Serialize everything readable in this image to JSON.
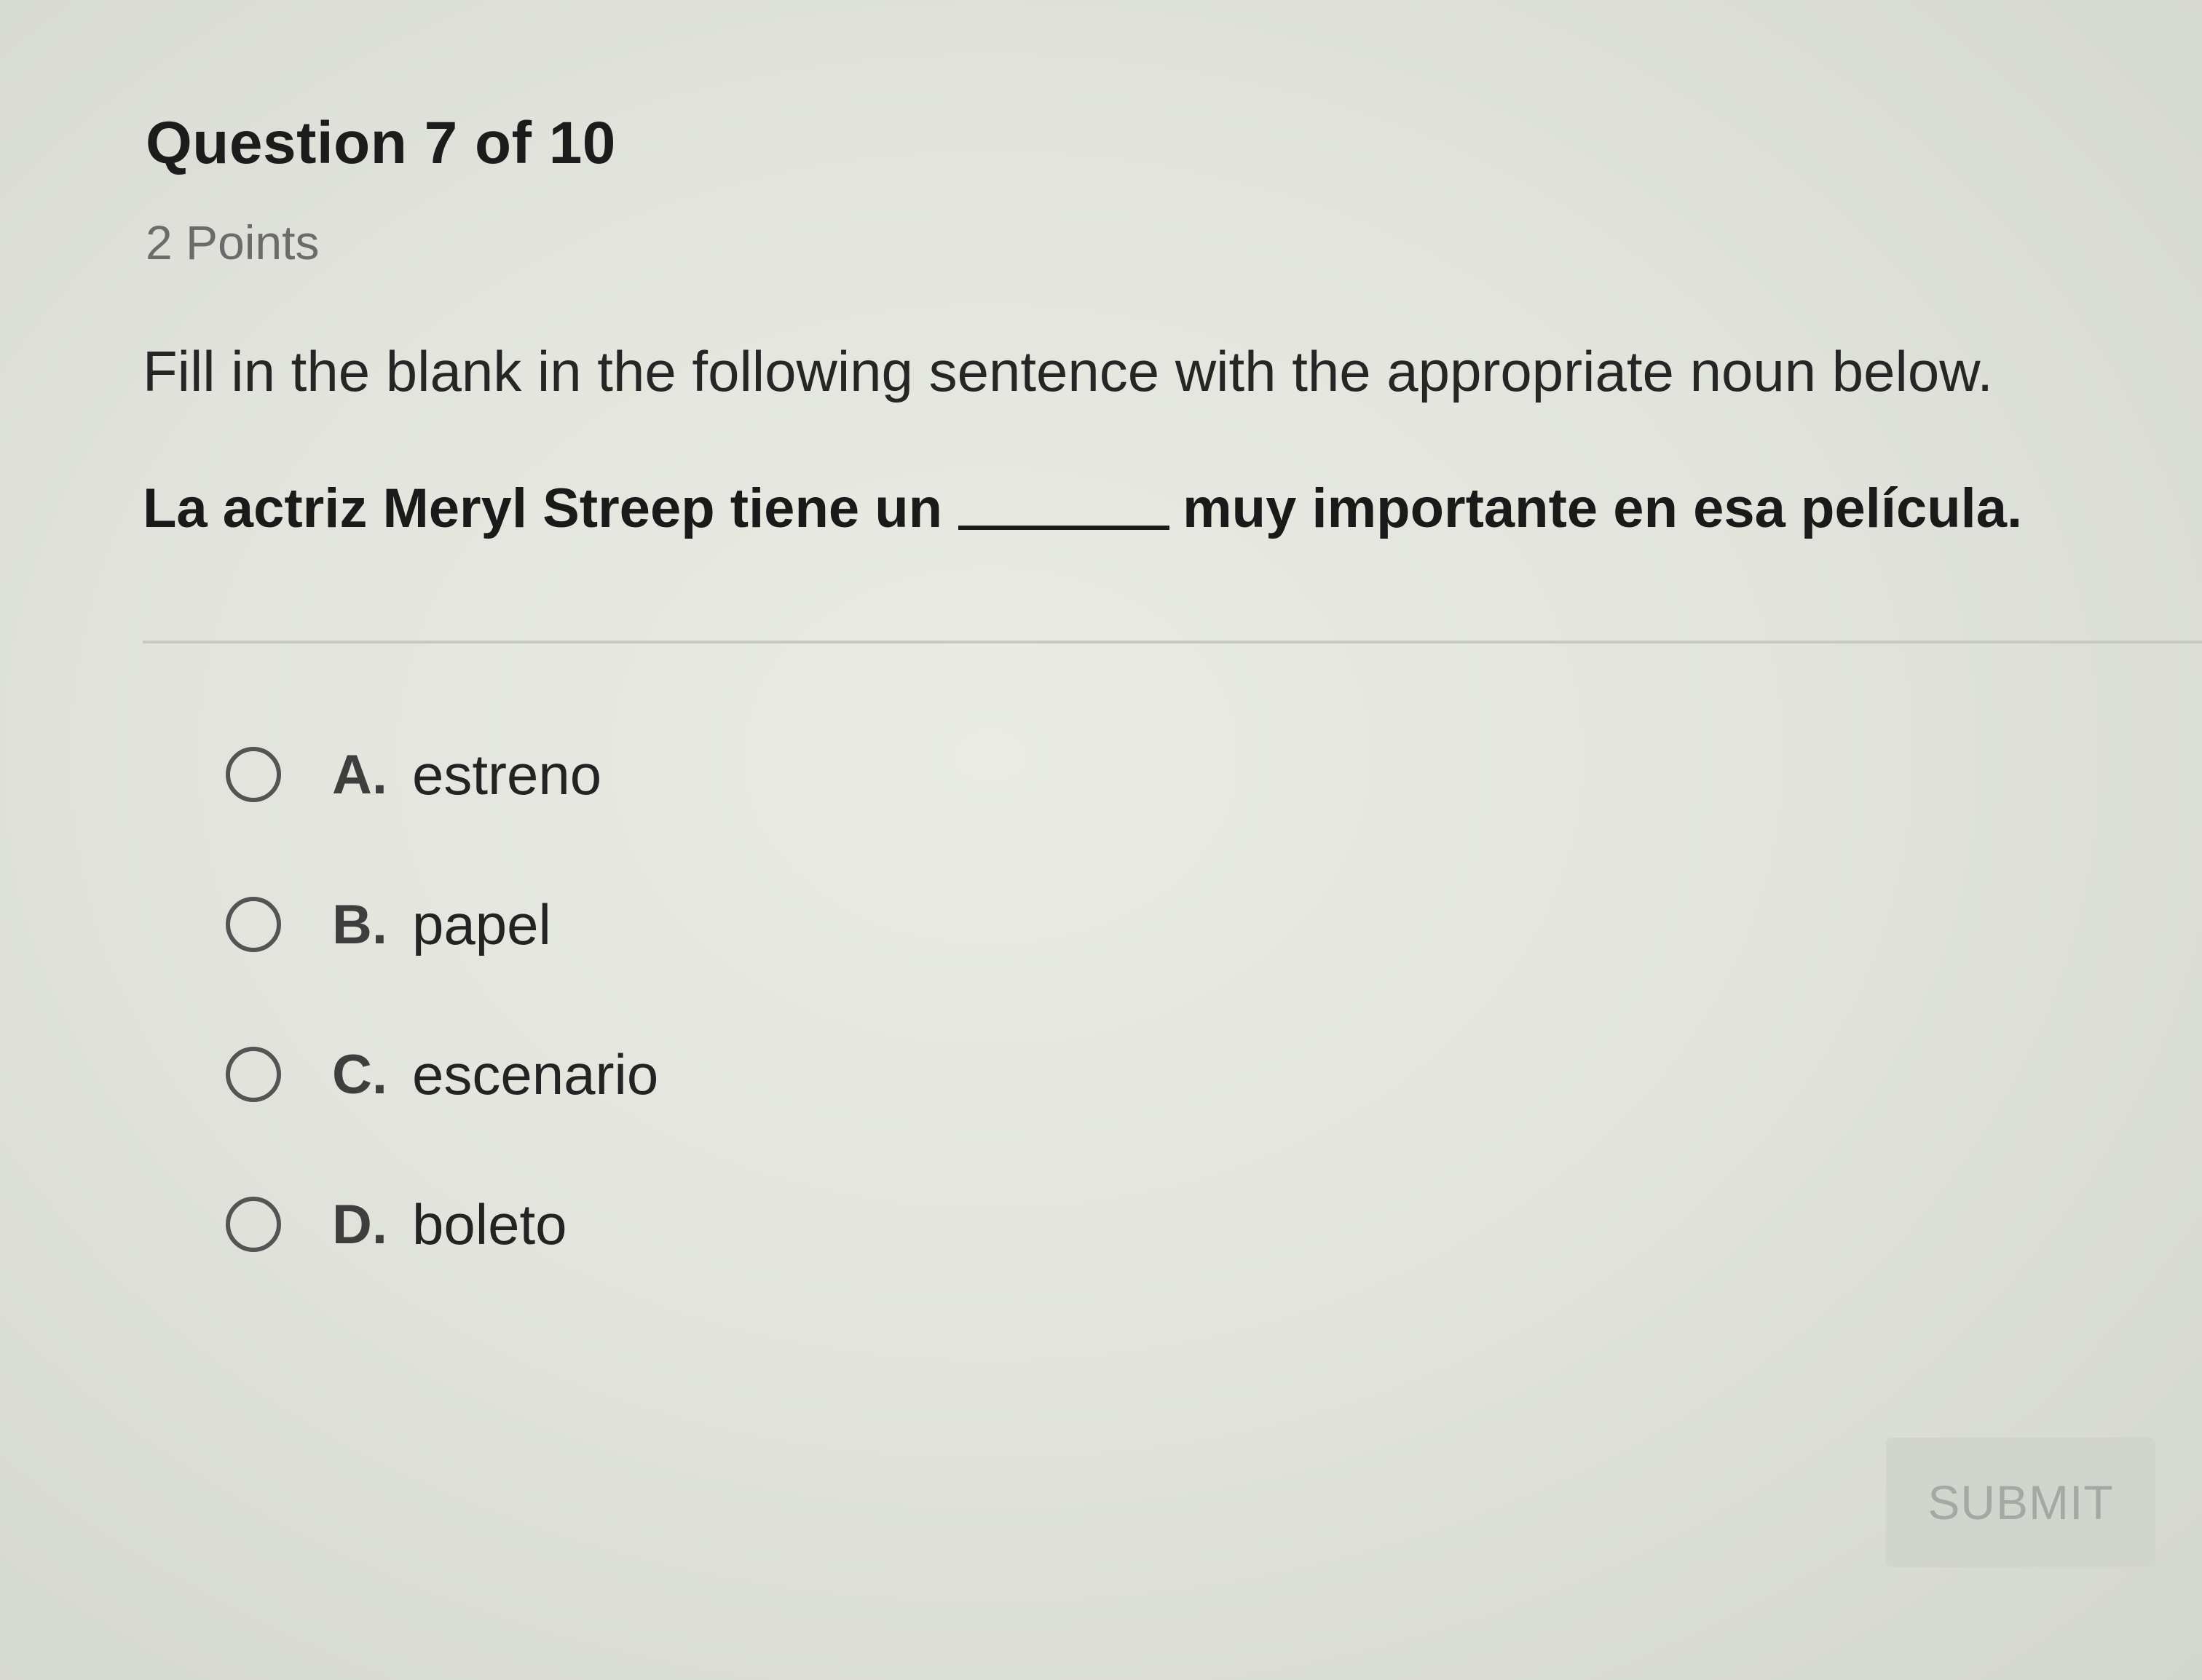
{
  "question": {
    "title": "Question 7 of 10",
    "points": "2 Points",
    "instruction": "Fill in the blank in the following sentence with the appropriate noun below.",
    "sentence_before": "La actriz Meryl Streep tiene un",
    "sentence_after": "muy importante en esa película."
  },
  "options": [
    {
      "letter": "A.",
      "text": "estreno",
      "selected": false
    },
    {
      "letter": "B.",
      "text": "papel",
      "selected": false
    },
    {
      "letter": "C.",
      "text": "escenario",
      "selected": false
    },
    {
      "letter": "D.",
      "text": "boleto",
      "selected": false
    }
  ],
  "submit_label": "SUBMIT"
}
